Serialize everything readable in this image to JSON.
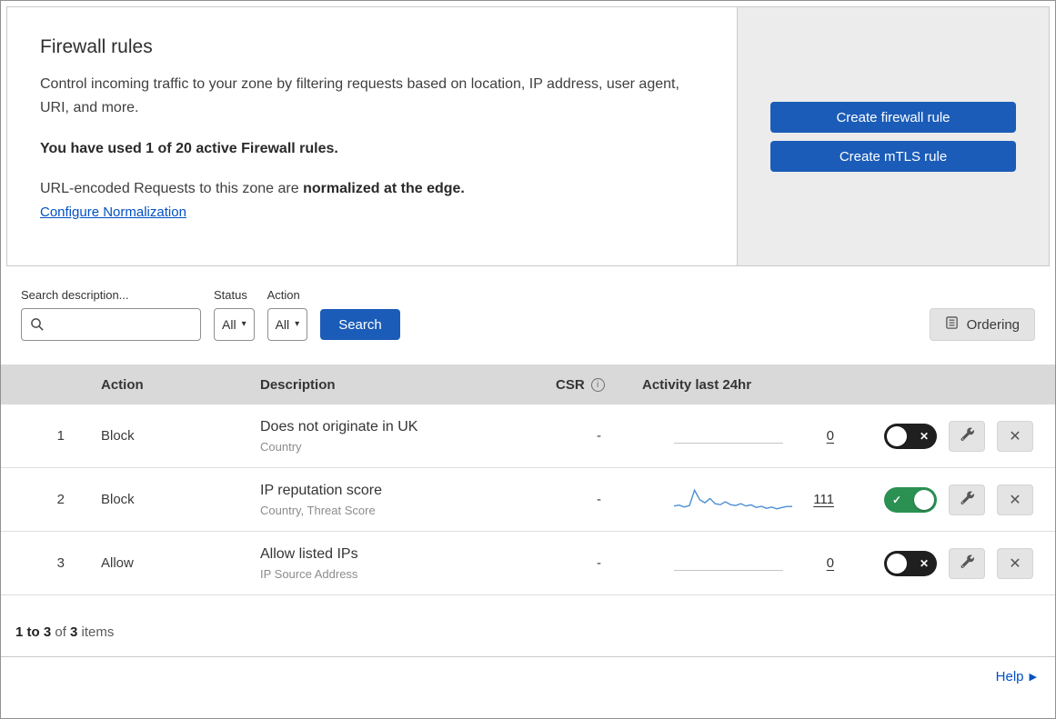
{
  "colors": {
    "accent-blue": "#1b5cb8",
    "link-blue": "#0051c3",
    "toggle-on-green": "#2b9153",
    "toggle-off-dark": "#1f1f1f",
    "table-header-bg": "#d9d9d9",
    "panel-gray": "#ececec",
    "sparkline-blue": "#4a8fd3"
  },
  "icons": {
    "search": "magnifier",
    "ordering": "list",
    "info": "i",
    "chevron_down": "▾",
    "toggle_on": "✓",
    "toggle_off": "✕",
    "delete": "✕",
    "edit": "wrench",
    "help_arrow": "▶"
  },
  "header": {
    "title": "Firewall rules",
    "description": "Control incoming traffic to your zone by filtering requests based on location, IP address, user agent, URI, and more.",
    "usage": "You have used 1 of 20 active Firewall rules.",
    "normalization_prefix": "URL-encoded Requests to this zone are ",
    "normalization_bold": "normalized at the edge.",
    "normalization_link": "Configure Normalization",
    "buttons": [
      {
        "label": "Create firewall rule"
      },
      {
        "label": "Create mTLS rule"
      }
    ]
  },
  "filters": {
    "search_label": "Search description...",
    "status_label": "Status",
    "status_value": "All",
    "action_label": "Action",
    "action_value": "All",
    "search_button": "Search",
    "ordering_button": "Ordering"
  },
  "table": {
    "columns": {
      "action": "Action",
      "description": "Description",
      "csr": "CSR",
      "activity": "Activity last 24hr"
    },
    "rows": [
      {
        "index": "1",
        "action": "Block",
        "description": "Does not originate in UK",
        "fields": "Country",
        "csr": "-",
        "activity_count": "0",
        "enabled": false,
        "sparkline": []
      },
      {
        "index": "2",
        "action": "Block",
        "description": "IP reputation score",
        "fields": "Country, Threat Score",
        "csr": "-",
        "activity_count": "111",
        "enabled": true,
        "sparkline": [
          28,
          32,
          24,
          30,
          95,
          55,
          42,
          60,
          38,
          34,
          46,
          34,
          30,
          38,
          28,
          33,
          22,
          27,
          18,
          24,
          16,
          22,
          26,
          26
        ]
      },
      {
        "index": "3",
        "action": "Allow",
        "description": "Allow listed IPs",
        "fields": "IP Source Address",
        "csr": "-",
        "activity_count": "0",
        "enabled": false,
        "sparkline": []
      }
    ]
  },
  "footer": {
    "range_bold": "1 to 3",
    "of_text": " of ",
    "total_bold": "3",
    "items_text": " items",
    "help_label": "Help"
  }
}
